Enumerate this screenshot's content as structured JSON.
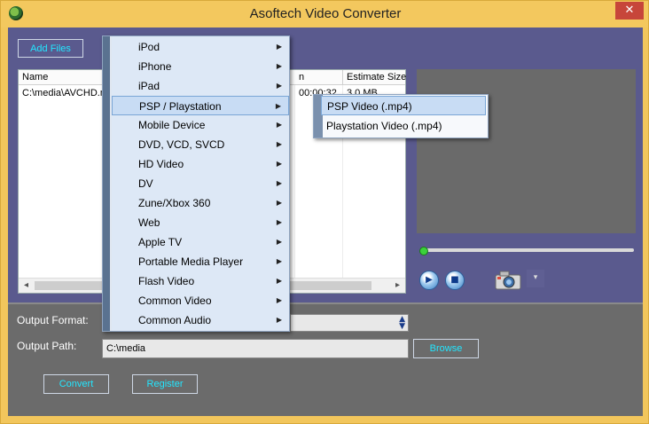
{
  "window": {
    "title": "Asoftech Video Converter",
    "close_glyph": "✕"
  },
  "toolbar": {
    "add_files": "Add Files"
  },
  "file_list": {
    "columns": [
      "Name",
      "n",
      "Estimate Size"
    ],
    "rows": [
      {
        "name": "C:\\media\\AVCHD.m",
        "mid": "00:00:32",
        "size": "3.0 MB"
      }
    ]
  },
  "player": {
    "play_icon": "▶",
    "stop_icon": "■",
    "snapshot_icon": "camera-icon",
    "dropdown_icon": "▾"
  },
  "output": {
    "format_label": "Output Format:",
    "path_label": "Output Path:",
    "path_value": "C:\\media",
    "browse": "Browse",
    "convert": "Convert",
    "register": "Register"
  },
  "menu": {
    "items": [
      "iPod",
      "iPhone",
      "iPad",
      "PSP / Playstation",
      "Mobile Device",
      "DVD, VCD, SVCD",
      "HD Video",
      "DV",
      "Zune/Xbox 360",
      "Web",
      "Apple TV",
      "Portable Media Player",
      "Flash Video",
      "Common Video",
      "Common Audio"
    ],
    "highlighted": "PSP / Playstation",
    "submenu": [
      "PSP Video (.mp4)",
      "Playstation Video (.mp4)"
    ],
    "submenu_highlighted": "PSP Video (.mp4)"
  },
  "colors": {
    "titlebar": "#f3c85e",
    "client": "#5a5a8e",
    "accent_text": "#23e6ff",
    "panel": "#6b6b6b"
  }
}
